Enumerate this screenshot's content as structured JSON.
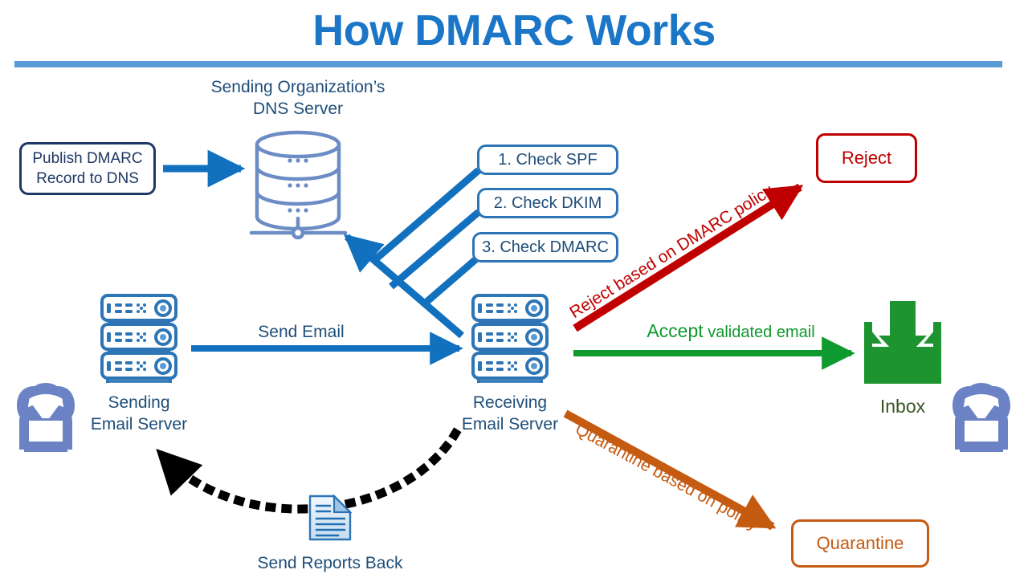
{
  "title": "How DMARC Works",
  "colors": {
    "title_blue": "#1B76C8",
    "rule_blue": "#5B9BD5",
    "arrow_blue": "#1271BE",
    "navy_text": "#1F3864",
    "label_blue": "#1F4E79",
    "box_blue_border": "#2E75B6",
    "reject_red": "#C00000",
    "accept_green": "#0E9A2E",
    "inbox_green": "#1E9431",
    "inbox_label_green": "#375623",
    "quarantine_orange": "#C55A11",
    "person_blue": "#6B83C4",
    "server_blue": "#2E75B6",
    "dotted_black": "#000000"
  },
  "dns": {
    "label": "Sending Organization’s\nDNS Server",
    "icon": "database-cylinder-stack-icon",
    "dots": [
      "...",
      "...",
      "..."
    ]
  },
  "publish_box": {
    "label": "Publish DMARC\nRecord to DNS"
  },
  "checks": [
    {
      "label": "1. Check SPF"
    },
    {
      "label": "2. Check DKIM"
    },
    {
      "label": "3. Check DMARC"
    }
  ],
  "sending_server": {
    "label": "Sending\nEmail Server",
    "icon": "server-rack-icon"
  },
  "receiving_server": {
    "label": "Receiving\nEmail Server",
    "icon": "server-rack-icon"
  },
  "arrows": {
    "send_email": "Send Email",
    "publish": "publish-arrow",
    "dns_query": "dns-query-arrow",
    "reject": "Reject based on DMARC policy",
    "accept_strong": "Accept",
    "accept_rest": " validated email",
    "quarantine": "Quarantine based on policy",
    "reports": "Send Reports Back"
  },
  "outcomes": {
    "reject": "Reject",
    "quarantine": "Quarantine",
    "inbox": "Inbox"
  },
  "icons": {
    "report_document": "document-report-icon",
    "inbox_tray": "inbox-tray-download-icon",
    "person_left": "person-at-laptop-icon",
    "person_right": "person-at-laptop-icon"
  }
}
